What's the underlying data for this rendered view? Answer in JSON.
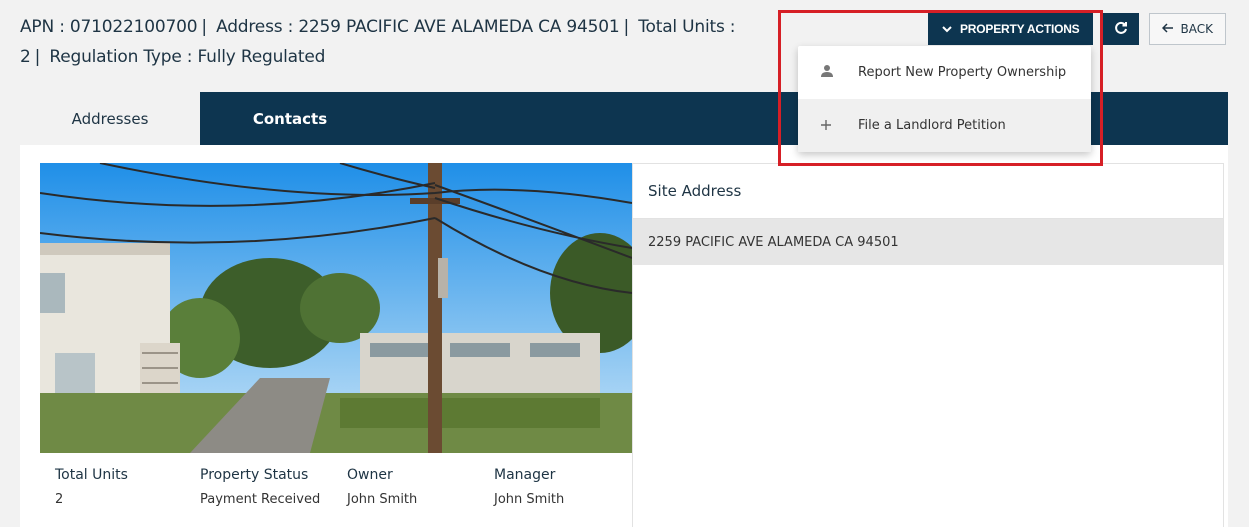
{
  "header": {
    "apn": "APN : 071022100700",
    "address": "Address : 2259 PACIFIC AVE ALAMEDA CA 94501",
    "total_units": "Total Units :",
    "total_units_value": "2",
    "regulation": "Regulation Type : Fully Regulated"
  },
  "actions": {
    "property_actions_label": "PROPERTY ACTIONS",
    "back_label": "BACK"
  },
  "dropdown": {
    "items": [
      {
        "label": "Report New Property Ownership",
        "icon": "person-icon"
      },
      {
        "label": "File a Landlord Petition",
        "icon": "plus-icon"
      }
    ]
  },
  "tabs": [
    {
      "label": "Addresses",
      "active": true
    },
    {
      "label": "Contacts",
      "active": false
    }
  ],
  "stats": [
    {
      "label": "Total Units",
      "value": "2"
    },
    {
      "label": "Property Status",
      "value": "Payment Received"
    },
    {
      "label": "Owner",
      "value": "John Smith"
    },
    {
      "label": "Manager",
      "value": "John Smith"
    }
  ],
  "site": {
    "heading": "Site Address",
    "address": "2259 PACIFIC AVE ALAMEDA CA 94501"
  },
  "colors": {
    "navy": "#0d3550",
    "highlight": "#d61f26"
  }
}
